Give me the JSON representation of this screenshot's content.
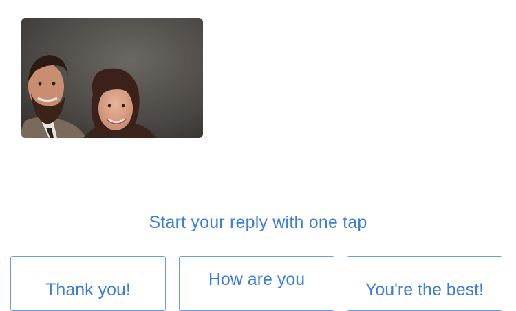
{
  "colors": {
    "accent": "#3b7ddd",
    "chip_border": "#6a9de8",
    "background": "#ffffff"
  },
  "attachment": {
    "kind": "photo",
    "subject": "portrait-of-couple"
  },
  "smart_reply": {
    "prompt": "Start your reply with one tap",
    "suggestions": [
      {
        "label": "Thank you!"
      },
      {
        "label": "How are you"
      },
      {
        "label": "You're the best!"
      }
    ]
  }
}
